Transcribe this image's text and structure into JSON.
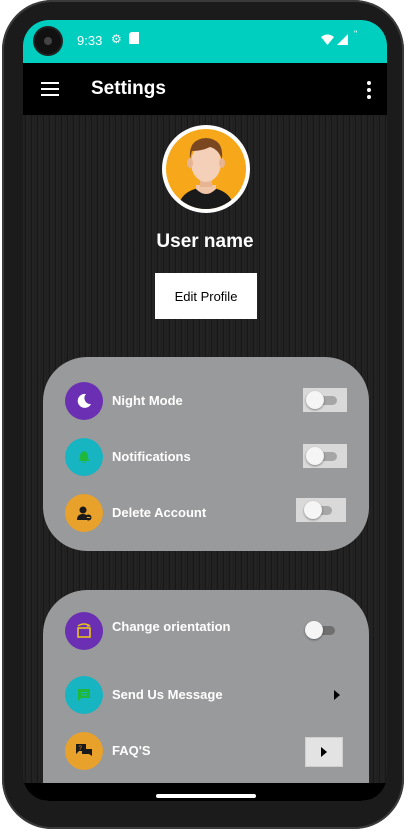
{
  "status_bar": {
    "time": "9:33"
  },
  "app_bar": {
    "title": "Settings"
  },
  "profile": {
    "user_name": "User name",
    "edit_label": "Edit Profile"
  },
  "card1": {
    "items": [
      {
        "label": "Night Mode",
        "icon": "moon-icon",
        "icon_color": "#6a2fb3",
        "toggle_on": false
      },
      {
        "label": "Notifications",
        "icon": "bell-icon",
        "icon_color": "#17b4c2",
        "toggle_on": false
      },
      {
        "label": "Delete Account",
        "icon": "user-remove-icon",
        "icon_color": "#e8a12a",
        "toggle_on": false
      }
    ]
  },
  "card2": {
    "items": [
      {
        "label": "Change orientation",
        "icon": "screen-rotation-icon",
        "icon_color": "#6a2fb3",
        "toggle_on": false
      },
      {
        "label": "Send Us Message",
        "icon": "chat-icon",
        "icon_color": "#17b4c2"
      },
      {
        "label": "FAQ'S",
        "icon": "question-chat-icon",
        "icon_color": "#e8a12a"
      }
    ]
  },
  "colors": {
    "status_bar": "#00cfc0",
    "card_background": "#999a9c",
    "avatar_background": "#f6a81a"
  }
}
